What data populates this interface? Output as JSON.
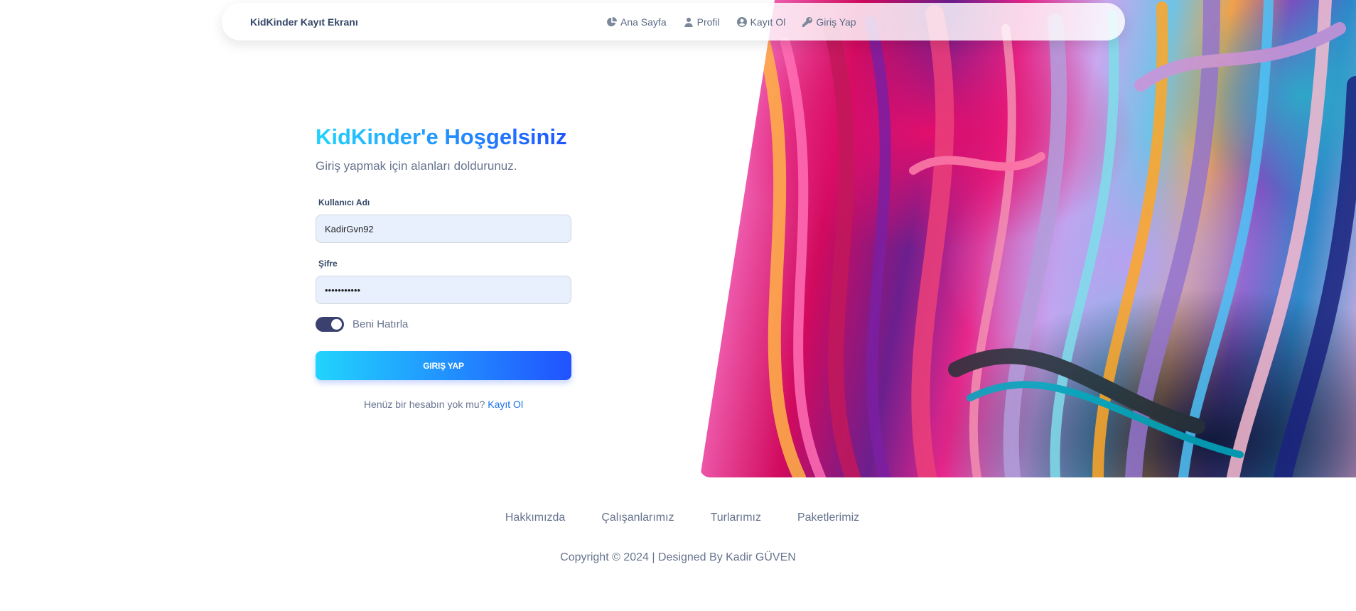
{
  "navbar": {
    "brand": "KidKinder Kayıt Ekranı",
    "links": [
      {
        "label": "Ana Sayfa",
        "icon": "pie-chart-icon"
      },
      {
        "label": "Profil",
        "icon": "user-icon"
      },
      {
        "label": "Kayıt Ol",
        "icon": "user-circle-icon"
      },
      {
        "label": "Giriş Yap",
        "icon": "key-icon"
      }
    ]
  },
  "login": {
    "title": "KidKinder'e Hoşgelsiniz",
    "subtitle": "Giriş yapmak için alanları doldurunuz.",
    "username_label": "Kullanıcı Adı",
    "username_value": "KadirGvn92",
    "password_label": "Şifre",
    "password_value": "•••••••••••",
    "remember_label": "Beni Hatırla",
    "remember_checked": true,
    "submit_label": "GIRIŞ YAP",
    "signup_prompt": "Henüz bir hesabın yok mu?",
    "signup_link": "Kayıt Ol"
  },
  "footer": {
    "links": [
      "Hakkımızda",
      "Çalışanlarımız",
      "Turlarımız",
      "Paketlerimiz"
    ],
    "copyright": "Copyright © 2024 | Designed By Kadir GÜVEN"
  },
  "colors": {
    "accent_start": "#21d4fd",
    "accent_end": "#2152ff",
    "toggle_on": "#3a416f",
    "text_dark": "#344767",
    "text_muted": "#67748e"
  }
}
